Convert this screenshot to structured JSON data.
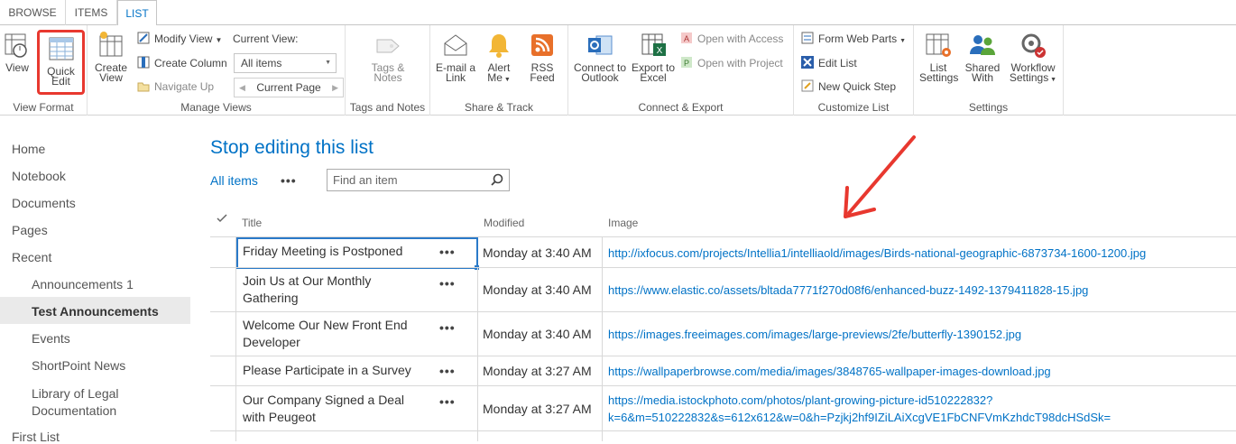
{
  "tabs": [
    "BROWSE",
    "ITEMS",
    "LIST"
  ],
  "ribbon": {
    "view_format": {
      "view": "View",
      "quick_edit": [
        "Quick",
        "Edit"
      ],
      "label": "View Format"
    },
    "manage_views": {
      "create_view": [
        "Create",
        "View"
      ],
      "modify_view": "Modify View",
      "create_column": "Create Column",
      "navigate_up": "Navigate Up",
      "current_view_label": "Current View:",
      "current_view_value": "All items",
      "current_page": "Current Page",
      "label": "Manage Views"
    },
    "tags_notes": {
      "button": [
        "Tags &",
        "Notes"
      ],
      "label": "Tags and Notes"
    },
    "share_track": {
      "email": [
        "E-mail a",
        "Link"
      ],
      "alert": [
        "Alert",
        "Me"
      ],
      "rss": [
        "RSS",
        "Feed"
      ],
      "label": "Share & Track"
    },
    "connect_export": {
      "outlook": [
        "Connect to",
        "Outlook"
      ],
      "excel": [
        "Export to",
        "Excel"
      ],
      "access": "Open with Access",
      "project": "Open with Project",
      "label": "Connect & Export"
    },
    "customize_list": {
      "form_web_parts": "Form Web Parts",
      "edit_list": "Edit List",
      "new_quick_step": "New Quick Step",
      "label": "Customize List"
    },
    "settings": {
      "list_settings": [
        "List",
        "Settings"
      ],
      "shared_with": [
        "Shared",
        "With"
      ],
      "workflow_settings": [
        "Workflow",
        "Settings"
      ],
      "label": "Settings"
    }
  },
  "leftnav": {
    "items": [
      {
        "label": "Home"
      },
      {
        "label": "Notebook"
      },
      {
        "label": "Documents"
      },
      {
        "label": "Pages"
      },
      {
        "label": "Recent"
      },
      {
        "label": "Announcements 1"
      },
      {
        "label": "Test Announcements"
      },
      {
        "label": "Events"
      },
      {
        "label": "ShortPoint News"
      },
      {
        "label": "Library of Legal Documentation",
        "lines": [
          "Library of Legal",
          "Documentation"
        ]
      },
      {
        "label": "First List"
      }
    ]
  },
  "main": {
    "title": "Stop editing this list",
    "view_name": "All items",
    "more": "•••",
    "search_placeholder": "Find an item",
    "columns": {
      "title": "Title",
      "modified": "Modified",
      "image": "Image"
    },
    "rows": [
      {
        "title": [
          "Friday Meeting is Postponed"
        ],
        "modified": "Monday at 3:40 AM",
        "image": [
          "http://ixfocus.com/projects/Intellia1/intelliaold/images/Birds-national-geographic-6873734-1600-1200.jpg"
        ]
      },
      {
        "title": [
          "Join Us at Our Monthly",
          "Gathering"
        ],
        "modified": "Monday at 3:40 AM",
        "image": [
          "https://www.elastic.co/assets/bltada7771f270d08f6/enhanced-buzz-1492-1379411828-15.jpg"
        ]
      },
      {
        "title": [
          "Welcome Our New Front End",
          "Developer"
        ],
        "modified": "Monday at 3:40 AM",
        "image": [
          "https://images.freeimages.com/images/large-previews/2fe/butterfly-1390152.jpg"
        ]
      },
      {
        "title": [
          "Please Participate in a Survey"
        ],
        "modified": "Monday at 3:27 AM",
        "image": [
          "https://wallpaperbrowse.com/media/images/3848765-wallpaper-images-download.jpg"
        ]
      },
      {
        "title": [
          "Our Company Signed a Deal",
          "with Peugeot"
        ],
        "modified": "Monday at 3:27 AM",
        "image": [
          "https://media.istockphoto.com/photos/plant-growing-picture-id510222832?",
          "k=6&m=510222832&s=612x612&w=0&h=Pzjkj2hf9IZiLAiXcgVE1FbCNFVmKzhdcT98dcHSdSk="
        ]
      }
    ]
  },
  "colors": {
    "accent": "#0072c6",
    "highlight": "#e8382f"
  }
}
